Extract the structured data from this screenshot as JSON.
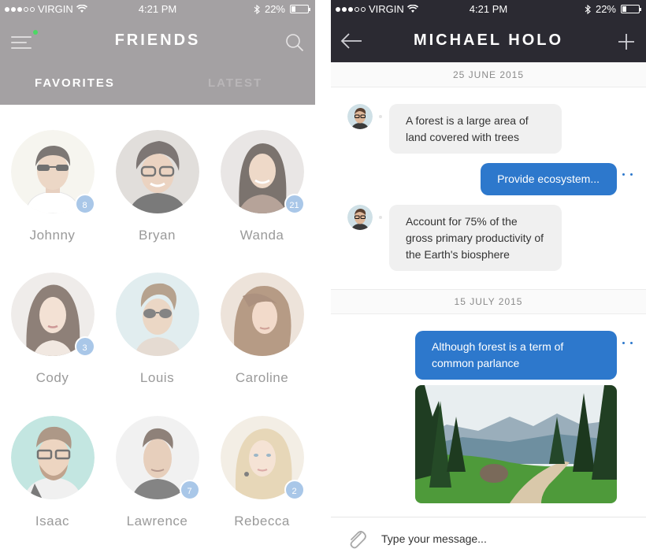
{
  "friends_screen": {
    "status_bar": {
      "carrier": "VIRGIN",
      "time": "4:21 PM",
      "battery": "22%"
    },
    "title": "FRIENDS",
    "tabs": [
      {
        "label": "FAVORITES",
        "active": true
      },
      {
        "label": "LATEST",
        "active": false
      }
    ],
    "friends": [
      {
        "name": "Johnny",
        "badge": "8"
      },
      {
        "name": "Bryan",
        "badge": ""
      },
      {
        "name": "Wanda",
        "badge": "21"
      },
      {
        "name": "Cody",
        "badge": "3"
      },
      {
        "name": "Louis",
        "badge": ""
      },
      {
        "name": "Caroline",
        "badge": ""
      },
      {
        "name": "Isaac",
        "badge": ""
      },
      {
        "name": "Lawrence",
        "badge": "7"
      },
      {
        "name": "Rebecca",
        "badge": "2"
      }
    ],
    "icons": {
      "menu": "hamburger-menu-icon",
      "search": "search-icon",
      "online_dot": "online-indicator"
    },
    "colors": {
      "header_bg": "#a4a1a3",
      "badge_bg": "#a9c7e8",
      "online": "#4cd964"
    }
  },
  "chat_screen": {
    "status_bar": {
      "carrier": "VIRGIN",
      "time": "4:21 PM",
      "battery": "22%"
    },
    "title": "MICHAEL HOLO",
    "dates": [
      "25 JUNE 2015",
      "15 JULY 2015"
    ],
    "messages": [
      {
        "direction": "incoming",
        "text": "A forest is a large area of land covered with trees"
      },
      {
        "direction": "outgoing",
        "text": "Provide ecosystem..."
      },
      {
        "direction": "incoming",
        "text": "Account for 75% of the gross primary productivity of the Earth's biosphere"
      },
      {
        "direction": "outgoing",
        "text": "Although forest is a term of common parlance"
      },
      {
        "direction": "outgoing",
        "type": "image",
        "image": "forest-mountain-photo"
      }
    ],
    "composer": {
      "placeholder": "Type your message..."
    },
    "icons": {
      "back": "back-arrow-icon",
      "add": "plus-icon",
      "attach": "paperclip-icon"
    },
    "colors": {
      "header_bg": "#2b2a32",
      "outgoing_bubble": "#2d78cc",
      "incoming_bubble": "#f0f0f0"
    }
  }
}
